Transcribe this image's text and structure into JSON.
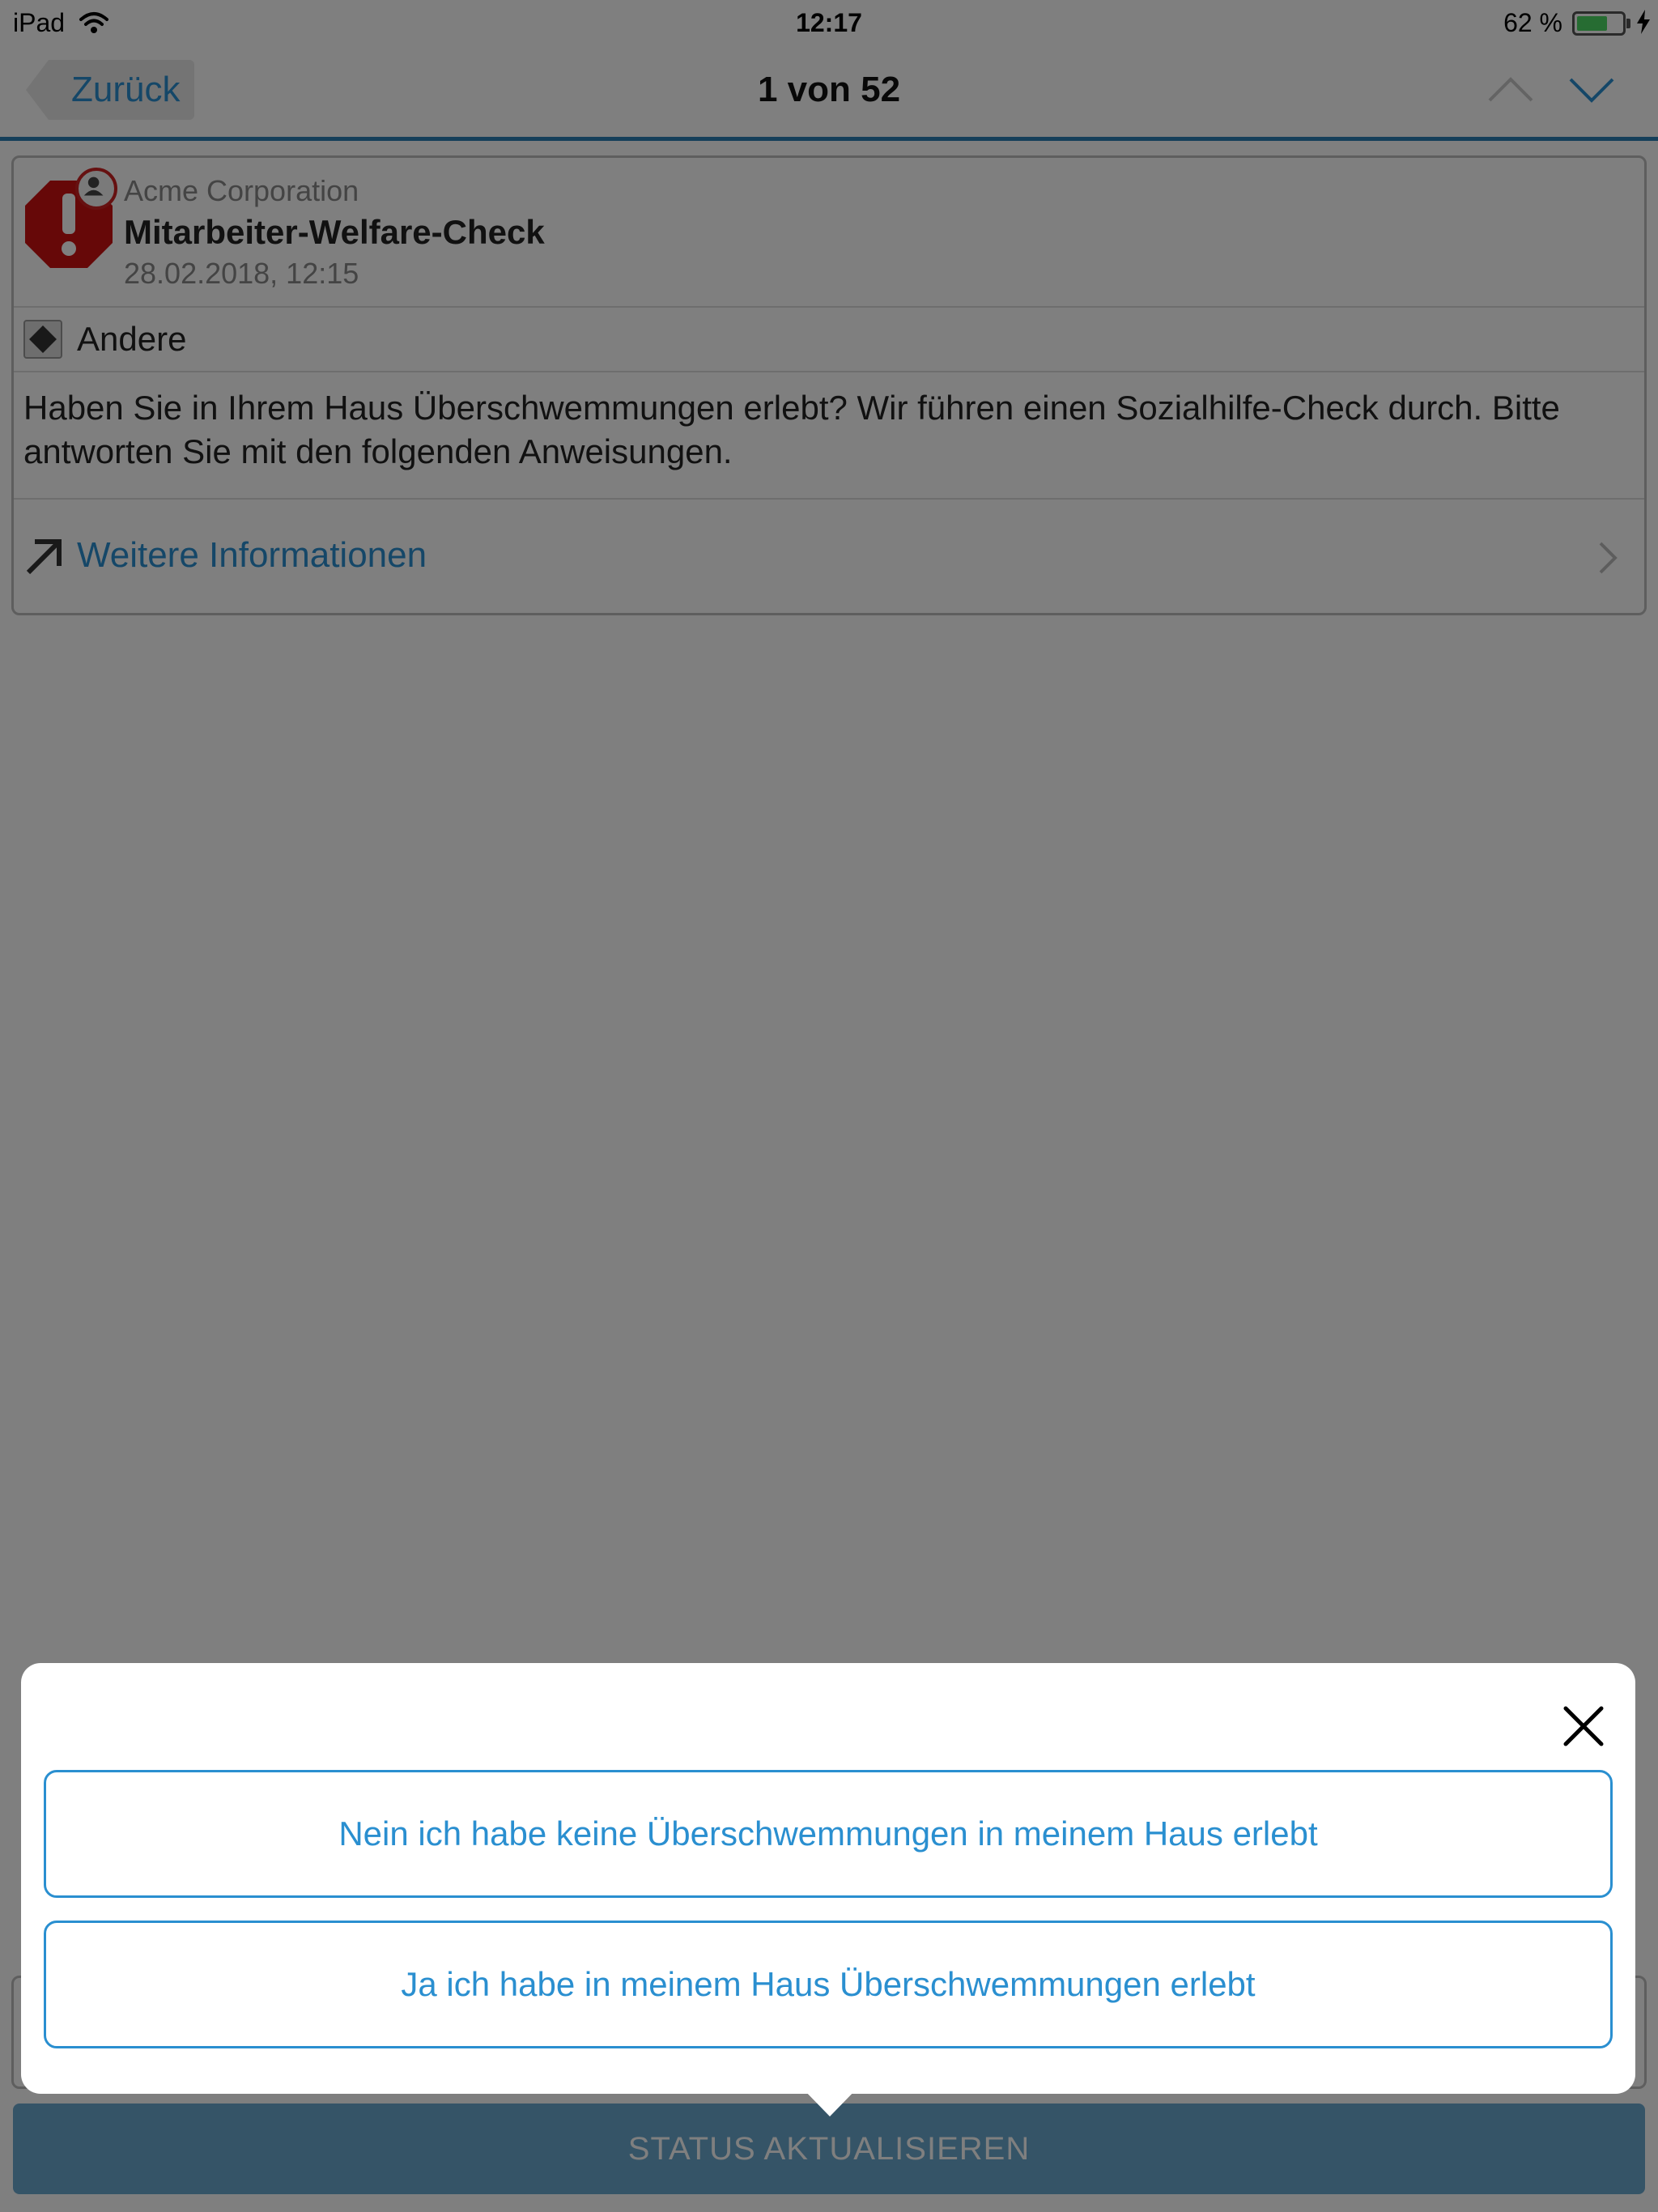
{
  "status_bar": {
    "device": "iPad",
    "time": "12:17",
    "battery": "62 %",
    "battery_level": 0.62
  },
  "nav": {
    "back_label": "Zurück",
    "title": "1 von 52"
  },
  "alert": {
    "organization": "Acme Corporation",
    "title": "Mitarbeiter-Welfare-Check",
    "date": "28.02.2018, 12:15",
    "category": "Andere",
    "message": "Haben Sie in Ihrem Haus Überschwemmungen erlebt? Wir führen einen Sozialhilfe-Check durch. Bitte antworten Sie mit den folgenden Anweisungen.",
    "more_info_label": "Weitere Informationen"
  },
  "popover": {
    "options": [
      {
        "label": "Nein ich habe keine Überschwemmungen in meinem Haus erlebt"
      },
      {
        "label": "Ja ich habe in meinem Haus Überschwemmungen erlebt"
      }
    ]
  },
  "footer": {
    "status_button_label": "STATUS AKTUALISIEREN"
  },
  "colors": {
    "accent": "#2a8fd0",
    "nav_border": "#2a7fb5",
    "alert_red": "#cc2222",
    "status_button": "#6aa9cf"
  }
}
